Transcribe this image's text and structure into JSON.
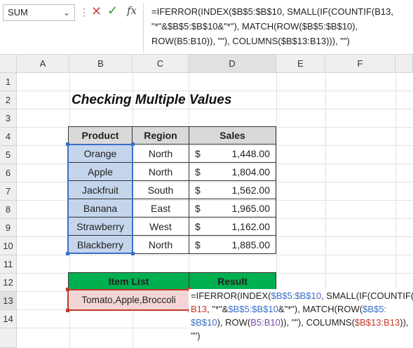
{
  "formula_bar": {
    "name_box": "SUM",
    "fx_label": "fx",
    "formula_lines": [
      "=IFERROR(INDEX($B$5:$B$10, SMALL(IF(COUNTIF(B13,",
      "\"*\"&$B$5:$B$10&\"*\"), MATCH(ROW($B$5:$B$10),",
      "ROW(B5:B10)), \"\"), COLUMNS($B$13:B13))), \"\")"
    ]
  },
  "columns": [
    "A",
    "B",
    "C",
    "D",
    "E",
    "F"
  ],
  "rows": [
    "1",
    "2",
    "3",
    "4",
    "5",
    "6",
    "7",
    "8",
    "9",
    "10",
    "11",
    "12",
    "13",
    "14"
  ],
  "sheet": {
    "title": "Checking Multiple Values",
    "table_headers": {
      "product": "Product",
      "region": "Region",
      "sales": "Sales"
    },
    "table_rows": [
      {
        "product": "Orange",
        "region": "North",
        "currency": "$",
        "sales": "1,448.00"
      },
      {
        "product": "Apple",
        "region": "North",
        "currency": "$",
        "sales": "1,804.00"
      },
      {
        "product": "Jackfruit",
        "region": "South",
        "currency": "$",
        "sales": "1,562.00"
      },
      {
        "product": "Banana",
        "region": "East",
        "currency": "$",
        "sales": "1,965.00"
      },
      {
        "product": "Strawberry",
        "region": "West",
        "currency": "$",
        "sales": "1,162.00"
      },
      {
        "product": "Blackberry",
        "region": "North",
        "currency": "$",
        "sales": "1,885.00"
      }
    ],
    "item_list_header": "Item List",
    "result_header": "Result",
    "item_list_value": "Tomato,Apple,Broccoli",
    "result_formula": {
      "l1a": "=IFERROR(INDEX(",
      "l1b": "$B$5:$B$10",
      "l1c": ", SMALL(IF(COUNTIF(",
      "l2a": "B13",
      "l2b": ", \"*\"&",
      "l2c": "$B$5:$B$10",
      "l2d": "&\"*\"), MATCH(ROW(",
      "l2e": "$B$5:",
      "l3a": "$B$10",
      "l3b": "), ROW(",
      "l3c": "B5:B10",
      "l3d": ")), \"\"), COLUMNS(",
      "l3e": "$B$13:B13",
      "l3f": ")),",
      "l4a": "\"\")"
    }
  },
  "colors": {
    "header_green": "#00b050",
    "header_grey": "#d9d9d9",
    "selection_blue": "#c5d5ec",
    "selection_red": "#f4d5d5"
  }
}
